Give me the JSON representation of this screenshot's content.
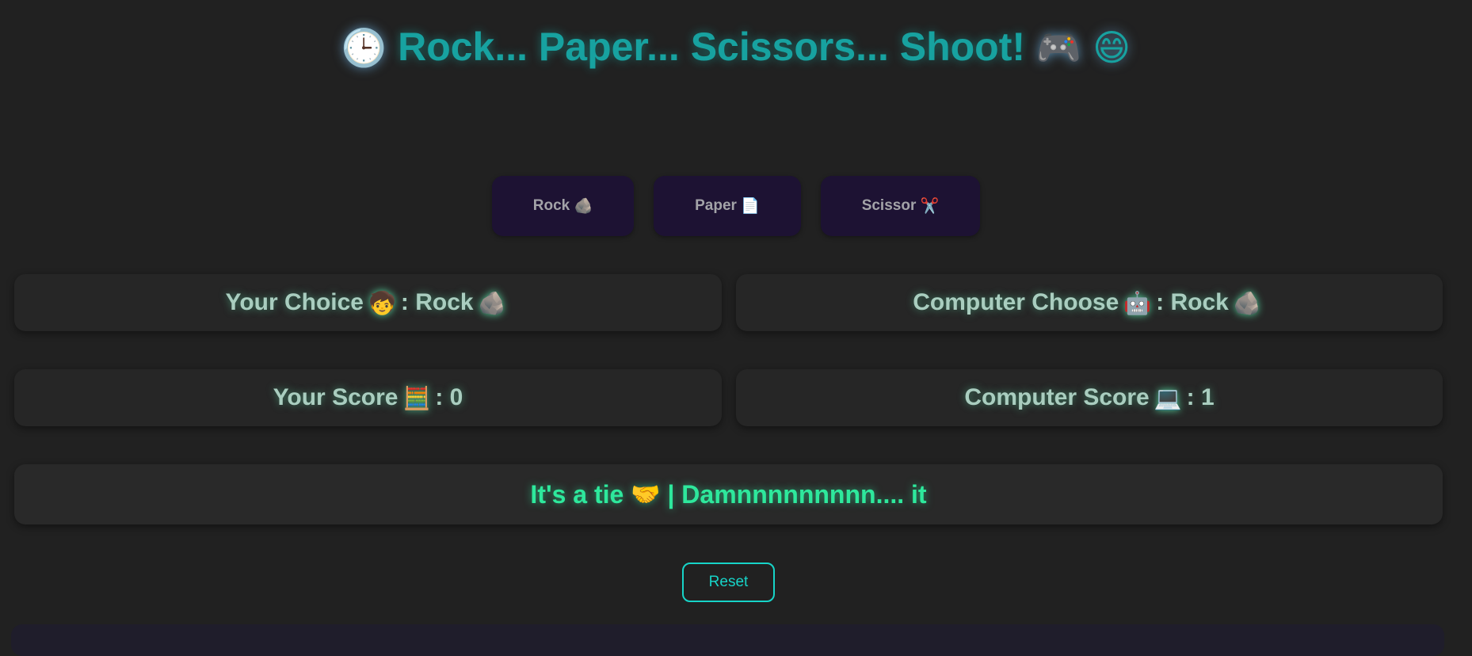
{
  "header": {
    "icon_left": "🕒",
    "title": "Rock... Paper... Scissors... Shoot!",
    "icon_right_1": "🎮",
    "icon_right_2": "😄"
  },
  "choices": [
    {
      "label": "Rock",
      "icon": "🪨"
    },
    {
      "label": "Paper",
      "icon": "📄"
    },
    {
      "label": "Scissor",
      "icon": "✂️"
    }
  ],
  "your_choice": {
    "label": "Your Choice",
    "icon": "🧒",
    "separator": ":",
    "value": "Rock",
    "value_icon": "🪨"
  },
  "computer_choice": {
    "label": "Computer Choose",
    "icon": "🤖",
    "separator": ":",
    "value": "Rock",
    "value_icon": "🪨"
  },
  "your_score": {
    "label": "Your Score",
    "icon": "🧮",
    "separator": ":",
    "value": "0"
  },
  "computer_score": {
    "label": "Computer Score",
    "icon": "💻",
    "separator": ":",
    "value": "1"
  },
  "result": {
    "text_1": "It's a tie",
    "icon": "🤝",
    "text_2": "| Damnnnnnnnnn.... it"
  },
  "reset": {
    "label": "Reset"
  },
  "colors": {
    "background": "#212121",
    "title": "#17a2a0",
    "card_text": "#a9cdbf",
    "result_text": "#2ee89c",
    "reset_accent": "#17d4c8",
    "choice_button_bg": "#1d1233"
  }
}
